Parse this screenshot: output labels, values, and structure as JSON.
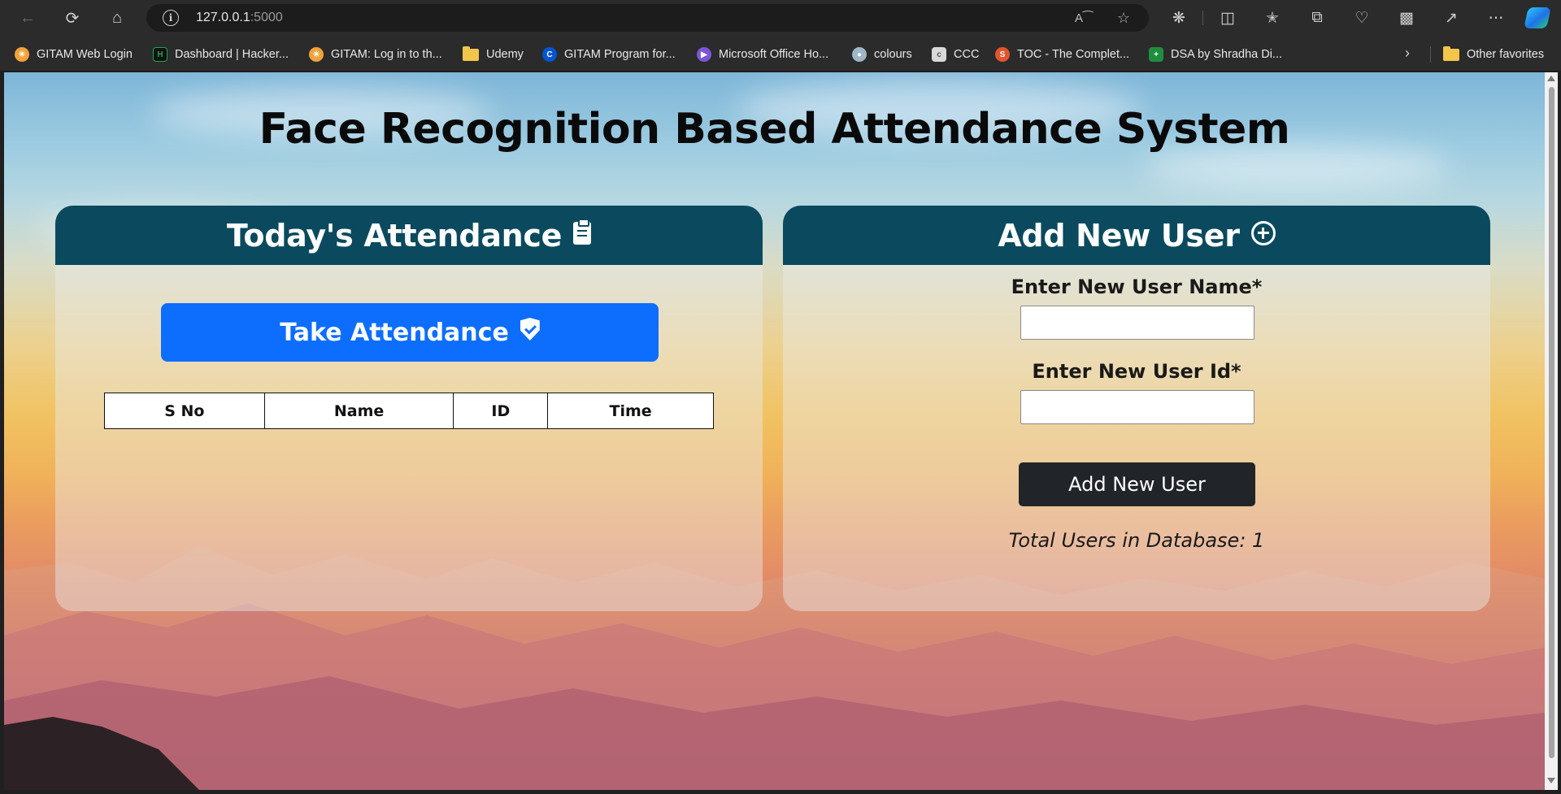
{
  "browser": {
    "url_host": "127.0.0.1",
    "url_port": ":5000",
    "bookmarks": [
      {
        "label": "GITAM Web Login",
        "icon": "gitam-logo-icon",
        "color": "#f0a23a"
      },
      {
        "label": "Dashboard | Hacker...",
        "icon": "hackerrank-icon",
        "color": "#1ba94c"
      },
      {
        "label": "GITAM: Log in to th...",
        "icon": "gitam-logo-icon",
        "color": "#f0a23a"
      },
      {
        "label": "Udemy",
        "icon": "folder-icon",
        "color": "#f3c54a"
      },
      {
        "label": "GITAM Program for...",
        "icon": "coursera-icon",
        "color": "#0056d2"
      },
      {
        "label": "Microsoft Office Ho...",
        "icon": "microsoft-office-icon",
        "color": "#7b55d8"
      },
      {
        "label": "colours",
        "icon": "palette-icon",
        "color": "#9fb6c8"
      },
      {
        "label": "CCC",
        "icon": "ccc-icon",
        "color": "#d9d9d9"
      },
      {
        "label": "TOC - The Complet...",
        "icon": "toc-icon",
        "color": "#e2552d"
      },
      {
        "label": "DSA by Shradha Di...",
        "icon": "dsa-icon",
        "color": "#1e8e3e"
      }
    ],
    "other_favorites": "Other favorites"
  },
  "page": {
    "title": "Face Recognition Based Attendance System"
  },
  "attendance": {
    "heading": "Today's Attendance",
    "take_button": "Take Attendance",
    "columns": [
      "S No",
      "Name",
      "ID",
      "Time"
    ],
    "rows": []
  },
  "add_user": {
    "heading": "Add New User",
    "name_label": "Enter New User Name*",
    "name_value": "",
    "id_label": "Enter New User Id*",
    "id_value": "",
    "submit": "Add New User",
    "total_text": "Total Users in Database: 1"
  },
  "colors": {
    "card_header": "#0b4a5e",
    "primary_button": "#0d6efd",
    "dark_button": "#212529"
  }
}
